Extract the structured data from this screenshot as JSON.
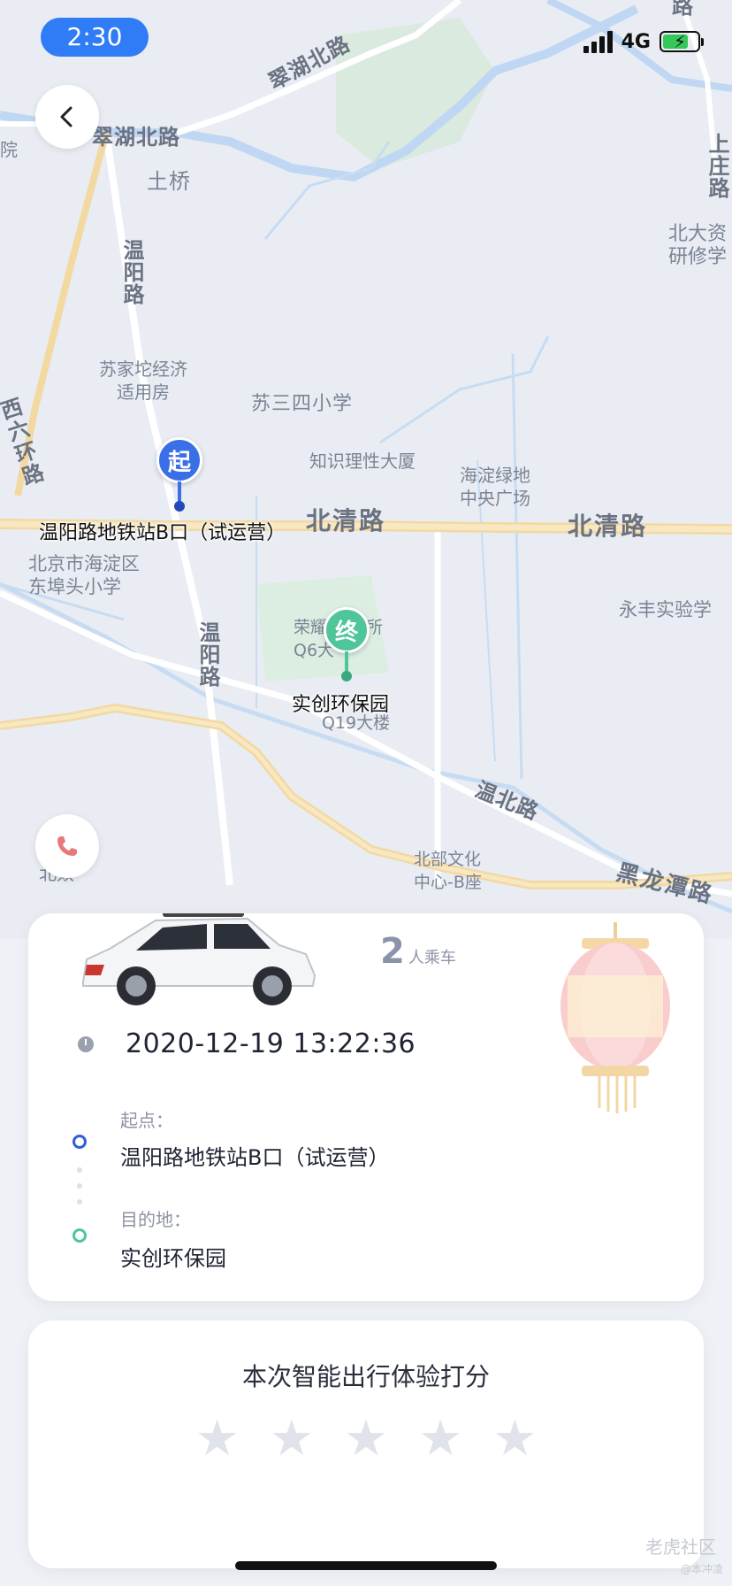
{
  "status_bar": {
    "time": "2:30",
    "network": "4G"
  },
  "map": {
    "labels": {
      "cuihu_1": "翠湖北路",
      "cuihu_2": "翠湖北路",
      "tuqiao": "土桥",
      "wenyang_1": "温阳路",
      "wenyang_2": "温阳路",
      "sujiatuo": "苏家坨经济\n适用房",
      "susansi": "苏三四小学",
      "xiliuhuan": "西六环路",
      "zhishi": "知识理性大厦",
      "haidian_green": "海淀绿地\n中央广场",
      "beiqing_1": "北清路",
      "beiqing_2": "北清路",
      "dongbu": "北京市海淀区\n东埠头小学",
      "rongyao": "荣耀  研究所\nQ6大",
      "q19": "Q19大楼",
      "yongfeng": "永丰实验学",
      "wenbei": "温北路",
      "beibu": "北部文化\n中心-B座",
      "heilongtan": "黑龙潭路",
      "shangzhuang": "上庄路",
      "beida": "北大资\n研修学",
      "topright_lu": "路",
      "left_yuan": "院",
      "bottom_left": "北奴"
    },
    "start_marker": {
      "glyph": "起",
      "label": "温阳路地铁站B口（试运营）",
      "color": "#3b6fe8"
    },
    "end_marker": {
      "glyph": "终",
      "label": "实创环保园",
      "color": "#4fc59a"
    }
  },
  "buttons": {
    "back_icon": "chevron-left-icon",
    "call_icon": "phone-icon"
  },
  "trip": {
    "riders_count": "2",
    "riders_unit": "人乘车",
    "datetime": "2020-12-19 13:22:36",
    "origin_label": "起点：",
    "origin_value": "温阳路地铁站B口（试运营）",
    "dest_label": "目的地：",
    "dest_value": "实创环保园",
    "origin_color": "#2f5fd6",
    "dest_color": "#4fc59a"
  },
  "rating": {
    "title": "本次智能出行体验打分",
    "stars_total": 5,
    "stars_selected": 0
  },
  "watermark": {
    "brand": "老虎社区",
    "handle": "@本冲凌"
  },
  "colors": {
    "accent_blue": "#2f7cf6",
    "star_empty": "#e0e3ea"
  }
}
